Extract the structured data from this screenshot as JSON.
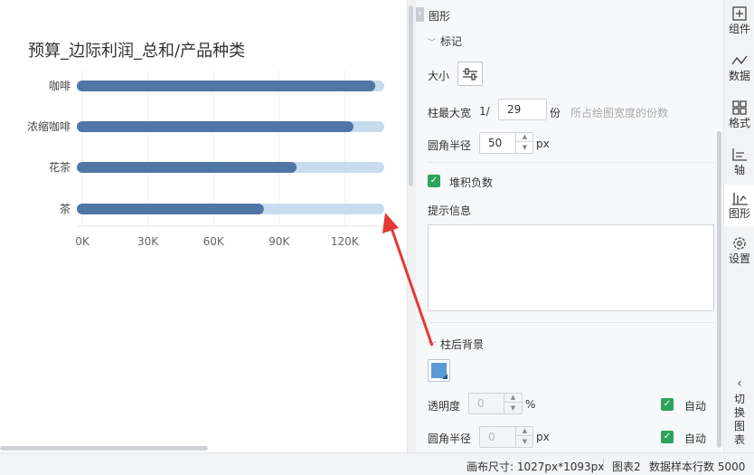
{
  "chart": {
    "title": "预算_边际利润_总和/产品种类",
    "colors": {
      "bar": "#4f76a6",
      "background_bar": "#c7dcee",
      "grid": "#eeeeee",
      "axis_text": "#666666"
    }
  },
  "chart_data": {
    "type": "bar",
    "orientation": "horizontal",
    "title": "预算_边际利润_总和/产品种类",
    "categories": [
      "咖啡",
      "浓缩咖啡",
      "花茶",
      "茶"
    ],
    "values": [
      134000,
      124000,
      98000,
      83000
    ],
    "xlim": [
      0,
      136000
    ],
    "x_ticks": [
      "0K",
      "30K",
      "60K",
      "90K",
      "120K"
    ],
    "x_tick_values": [
      0,
      30000,
      60000,
      90000,
      120000
    ],
    "grid": "vertical",
    "legend": "none"
  },
  "panel": {
    "title": "图形",
    "collapse_icon": "chevron-right-icon",
    "mark_section": "标记",
    "size_label": "大小",
    "bar_max_width_label": "柱最大宽",
    "bar_max_width_prefix": "1/",
    "bar_max_width_value": "29",
    "bar_max_width_unit": "份",
    "bar_max_width_hint": "所占绘图宽度的份数",
    "corner_radius_label": "圆角半径",
    "corner_radius_value": "50",
    "corner_radius_unit": "px",
    "stack_negative_label": "堆积负数",
    "stack_negative_checked": true,
    "tooltip_label": "提示信息",
    "bg_section": "柱后背景",
    "bg_color": "#5a9bd5",
    "opacity_label": "透明度",
    "opacity_value": "0",
    "opacity_unit": "%",
    "opacity_auto_label": "自动",
    "opacity_auto_checked": true,
    "bg_radius_label": "圆角半径",
    "bg_radius_value": "0",
    "bg_radius_unit": "px",
    "bg_radius_auto_label": "自动",
    "bg_radius_auto_checked": true
  },
  "rail": {
    "items": [
      {
        "label": "组件",
        "icon": "add-component-icon"
      },
      {
        "label": "数据",
        "icon": "data-icon"
      },
      {
        "label": "格式",
        "icon": "format-grid-icon"
      },
      {
        "label": "轴",
        "icon": "axis-icon"
      },
      {
        "label": "图形",
        "icon": "bar-graph-icon",
        "active": true
      },
      {
        "label": "设置",
        "icon": "gear-icon"
      }
    ],
    "switch_label": "切换图表",
    "switch_icon": "chevron-left-icon"
  },
  "status": {
    "canvas_size": "画布尺寸: 1027px*1093px",
    "chart_name": "图表2",
    "sample_rows": "数据样本行数 5000"
  }
}
